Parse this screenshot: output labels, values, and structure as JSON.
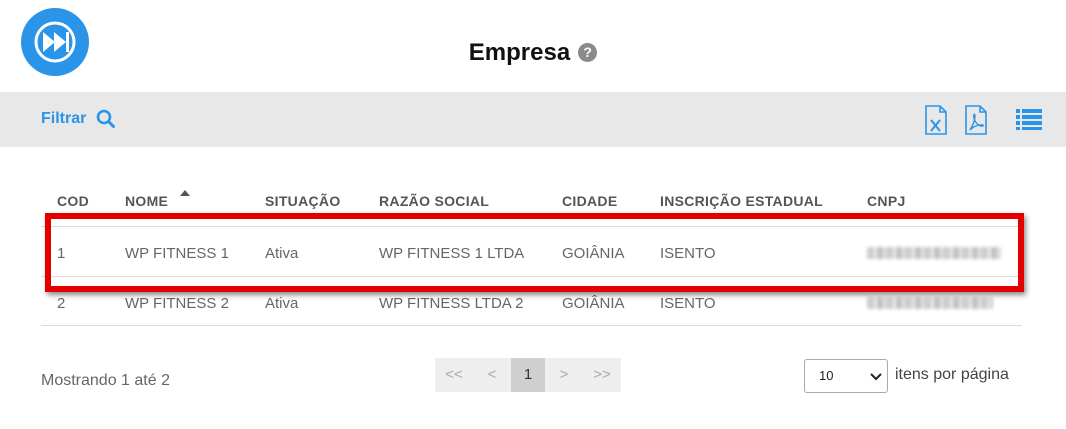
{
  "header": {
    "title": "Empresa",
    "help_icon": "help-icon",
    "help_glyph": "?"
  },
  "toolbar": {
    "filter_label": "Filtrar",
    "icons": [
      "search-icon",
      "excel-export-icon",
      "pdf-export-icon",
      "list-view-icon"
    ],
    "accent": "#2a94e8"
  },
  "table": {
    "columns": [
      "COD",
      "NOME",
      "SITUAÇÃO",
      "RAZÃO SOCIAL",
      "CIDADE",
      "INSCRIÇÃO ESTADUAL",
      "CNPJ"
    ],
    "sorted_by": "NOME",
    "rows": [
      {
        "cod": "1",
        "nome": "WP FITNESS 1",
        "situacao": "Ativa",
        "razao": "WP FITNESS 1 LTDA",
        "cidade": "GOIÂNIA",
        "ie": "ISENTO"
      },
      {
        "cod": "2",
        "nome": "WP FITNESS 2",
        "situacao": "Ativa",
        "razao": "WP FITNESS LTDA 2",
        "cidade": "GOIÂNIA",
        "ie": "ISENTO"
      }
    ],
    "highlight_color": "#e50000"
  },
  "footer": {
    "showing": "Mostrando 1 até 2",
    "pager": {
      "first": "<<",
      "prev": "<",
      "current": "1",
      "next": ">",
      "last": ">>"
    },
    "page_size": "10",
    "page_size_label": "itens por página"
  }
}
